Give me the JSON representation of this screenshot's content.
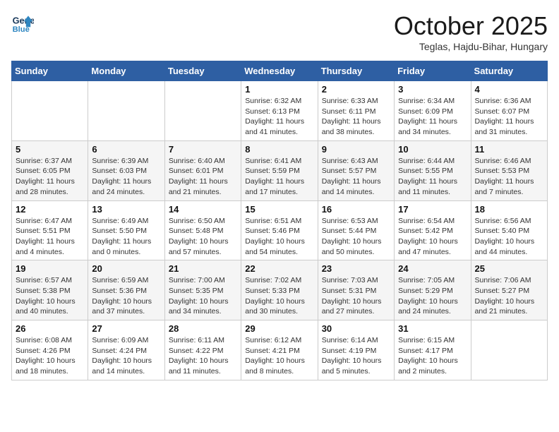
{
  "header": {
    "logo_line1": "General",
    "logo_line2": "Blue",
    "month": "October 2025",
    "location": "Teglas, Hajdu-Bihar, Hungary"
  },
  "weekdays": [
    "Sunday",
    "Monday",
    "Tuesday",
    "Wednesday",
    "Thursday",
    "Friday",
    "Saturday"
  ],
  "weeks": [
    [
      {
        "day": "",
        "info": ""
      },
      {
        "day": "",
        "info": ""
      },
      {
        "day": "",
        "info": ""
      },
      {
        "day": "1",
        "info": "Sunrise: 6:32 AM\nSunset: 6:13 PM\nDaylight: 11 hours\nand 41 minutes."
      },
      {
        "day": "2",
        "info": "Sunrise: 6:33 AM\nSunset: 6:11 PM\nDaylight: 11 hours\nand 38 minutes."
      },
      {
        "day": "3",
        "info": "Sunrise: 6:34 AM\nSunset: 6:09 PM\nDaylight: 11 hours\nand 34 minutes."
      },
      {
        "day": "4",
        "info": "Sunrise: 6:36 AM\nSunset: 6:07 PM\nDaylight: 11 hours\nand 31 minutes."
      }
    ],
    [
      {
        "day": "5",
        "info": "Sunrise: 6:37 AM\nSunset: 6:05 PM\nDaylight: 11 hours\nand 28 minutes."
      },
      {
        "day": "6",
        "info": "Sunrise: 6:39 AM\nSunset: 6:03 PM\nDaylight: 11 hours\nand 24 minutes."
      },
      {
        "day": "7",
        "info": "Sunrise: 6:40 AM\nSunset: 6:01 PM\nDaylight: 11 hours\nand 21 minutes."
      },
      {
        "day": "8",
        "info": "Sunrise: 6:41 AM\nSunset: 5:59 PM\nDaylight: 11 hours\nand 17 minutes."
      },
      {
        "day": "9",
        "info": "Sunrise: 6:43 AM\nSunset: 5:57 PM\nDaylight: 11 hours\nand 14 minutes."
      },
      {
        "day": "10",
        "info": "Sunrise: 6:44 AM\nSunset: 5:55 PM\nDaylight: 11 hours\nand 11 minutes."
      },
      {
        "day": "11",
        "info": "Sunrise: 6:46 AM\nSunset: 5:53 PM\nDaylight: 11 hours\nand 7 minutes."
      }
    ],
    [
      {
        "day": "12",
        "info": "Sunrise: 6:47 AM\nSunset: 5:51 PM\nDaylight: 11 hours\nand 4 minutes."
      },
      {
        "day": "13",
        "info": "Sunrise: 6:49 AM\nSunset: 5:50 PM\nDaylight: 11 hours\nand 0 minutes."
      },
      {
        "day": "14",
        "info": "Sunrise: 6:50 AM\nSunset: 5:48 PM\nDaylight: 10 hours\nand 57 minutes."
      },
      {
        "day": "15",
        "info": "Sunrise: 6:51 AM\nSunset: 5:46 PM\nDaylight: 10 hours\nand 54 minutes."
      },
      {
        "day": "16",
        "info": "Sunrise: 6:53 AM\nSunset: 5:44 PM\nDaylight: 10 hours\nand 50 minutes."
      },
      {
        "day": "17",
        "info": "Sunrise: 6:54 AM\nSunset: 5:42 PM\nDaylight: 10 hours\nand 47 minutes."
      },
      {
        "day": "18",
        "info": "Sunrise: 6:56 AM\nSunset: 5:40 PM\nDaylight: 10 hours\nand 44 minutes."
      }
    ],
    [
      {
        "day": "19",
        "info": "Sunrise: 6:57 AM\nSunset: 5:38 PM\nDaylight: 10 hours\nand 40 minutes."
      },
      {
        "day": "20",
        "info": "Sunrise: 6:59 AM\nSunset: 5:36 PM\nDaylight: 10 hours\nand 37 minutes."
      },
      {
        "day": "21",
        "info": "Sunrise: 7:00 AM\nSunset: 5:35 PM\nDaylight: 10 hours\nand 34 minutes."
      },
      {
        "day": "22",
        "info": "Sunrise: 7:02 AM\nSunset: 5:33 PM\nDaylight: 10 hours\nand 30 minutes."
      },
      {
        "day": "23",
        "info": "Sunrise: 7:03 AM\nSunset: 5:31 PM\nDaylight: 10 hours\nand 27 minutes."
      },
      {
        "day": "24",
        "info": "Sunrise: 7:05 AM\nSunset: 5:29 PM\nDaylight: 10 hours\nand 24 minutes."
      },
      {
        "day": "25",
        "info": "Sunrise: 7:06 AM\nSunset: 5:27 PM\nDaylight: 10 hours\nand 21 minutes."
      }
    ],
    [
      {
        "day": "26",
        "info": "Sunrise: 6:08 AM\nSunset: 4:26 PM\nDaylight: 10 hours\nand 18 minutes."
      },
      {
        "day": "27",
        "info": "Sunrise: 6:09 AM\nSunset: 4:24 PM\nDaylight: 10 hours\nand 14 minutes."
      },
      {
        "day": "28",
        "info": "Sunrise: 6:11 AM\nSunset: 4:22 PM\nDaylight: 10 hours\nand 11 minutes."
      },
      {
        "day": "29",
        "info": "Sunrise: 6:12 AM\nSunset: 4:21 PM\nDaylight: 10 hours\nand 8 minutes."
      },
      {
        "day": "30",
        "info": "Sunrise: 6:14 AM\nSunset: 4:19 PM\nDaylight: 10 hours\nand 5 minutes."
      },
      {
        "day": "31",
        "info": "Sunrise: 6:15 AM\nSunset: 4:17 PM\nDaylight: 10 hours\nand 2 minutes."
      },
      {
        "day": "",
        "info": ""
      }
    ]
  ]
}
